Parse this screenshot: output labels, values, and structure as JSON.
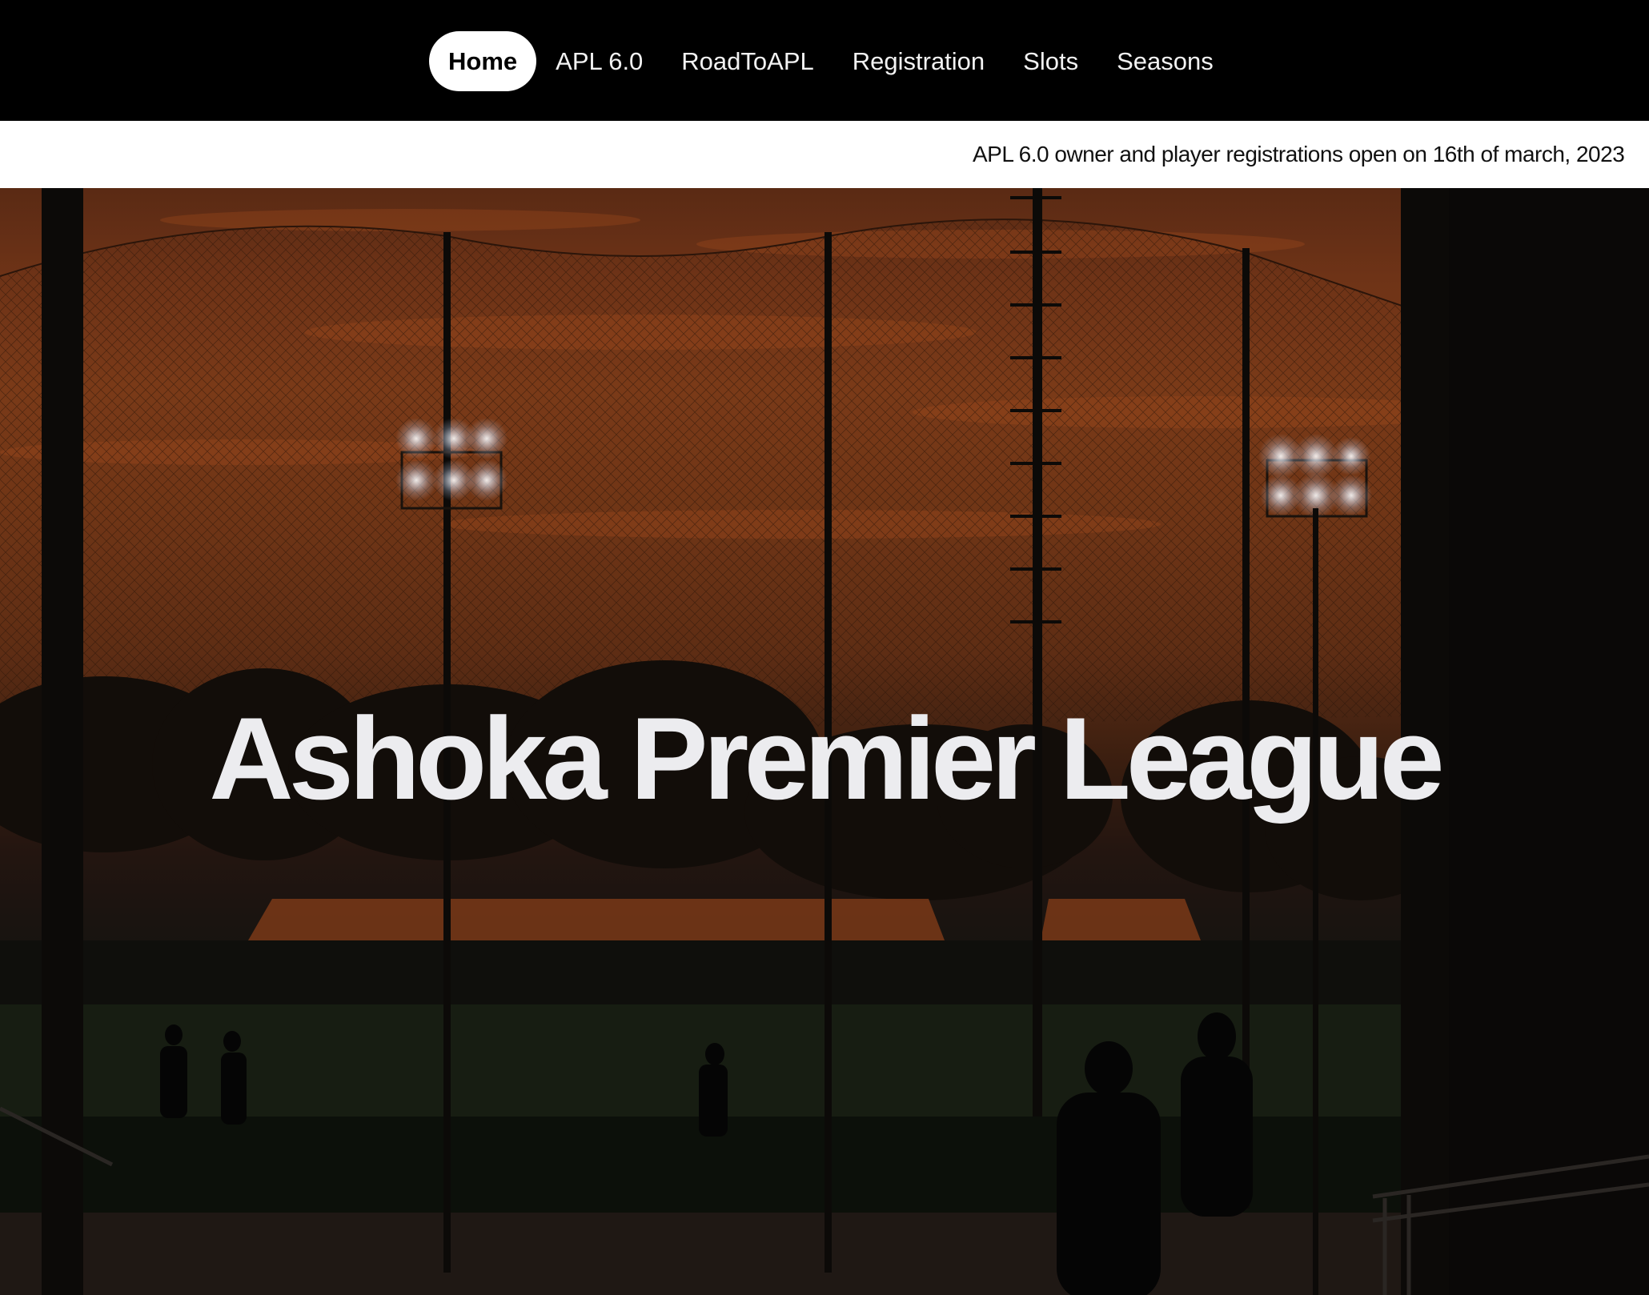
{
  "nav": {
    "items": [
      {
        "label": "Home",
        "active": true
      },
      {
        "label": "APL 6.0"
      },
      {
        "label": "RoadToAPL"
      },
      {
        "label": "Registration"
      },
      {
        "label": "Slots"
      },
      {
        "label": "Seasons"
      }
    ]
  },
  "ticker": {
    "text": "APL 6.0 owner and player registrations open on 16th of march, 2023"
  },
  "hero": {
    "title": "Ashoka Premier League",
    "image": "cricket-ground-at-dusk-with-floodlights"
  }
}
